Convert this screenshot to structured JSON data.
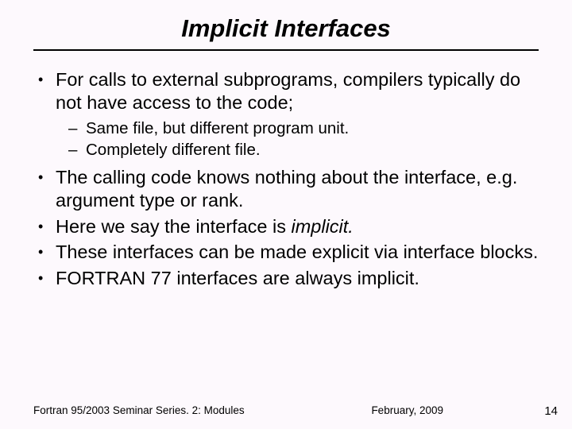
{
  "title": "Implicit Interfaces",
  "bullets": {
    "b1": "For calls to external subprograms, compilers typically do not have access to the code;",
    "sub1": "Same file, but different program unit.",
    "sub2": "Completely different file.",
    "b2": "The calling code knows nothing about the interface, e.g. argument type or rank.",
    "b3a": "Here we say the interface is ",
    "b3b": "implicit.",
    "b4": "These interfaces can be made explicit via interface blocks.",
    "b5": "FORTRAN 77 interfaces are always implicit."
  },
  "footer": {
    "left": "Fortran 95/2003 Seminar Series. 2: Modules",
    "date": "February, 2009"
  },
  "page": "14"
}
